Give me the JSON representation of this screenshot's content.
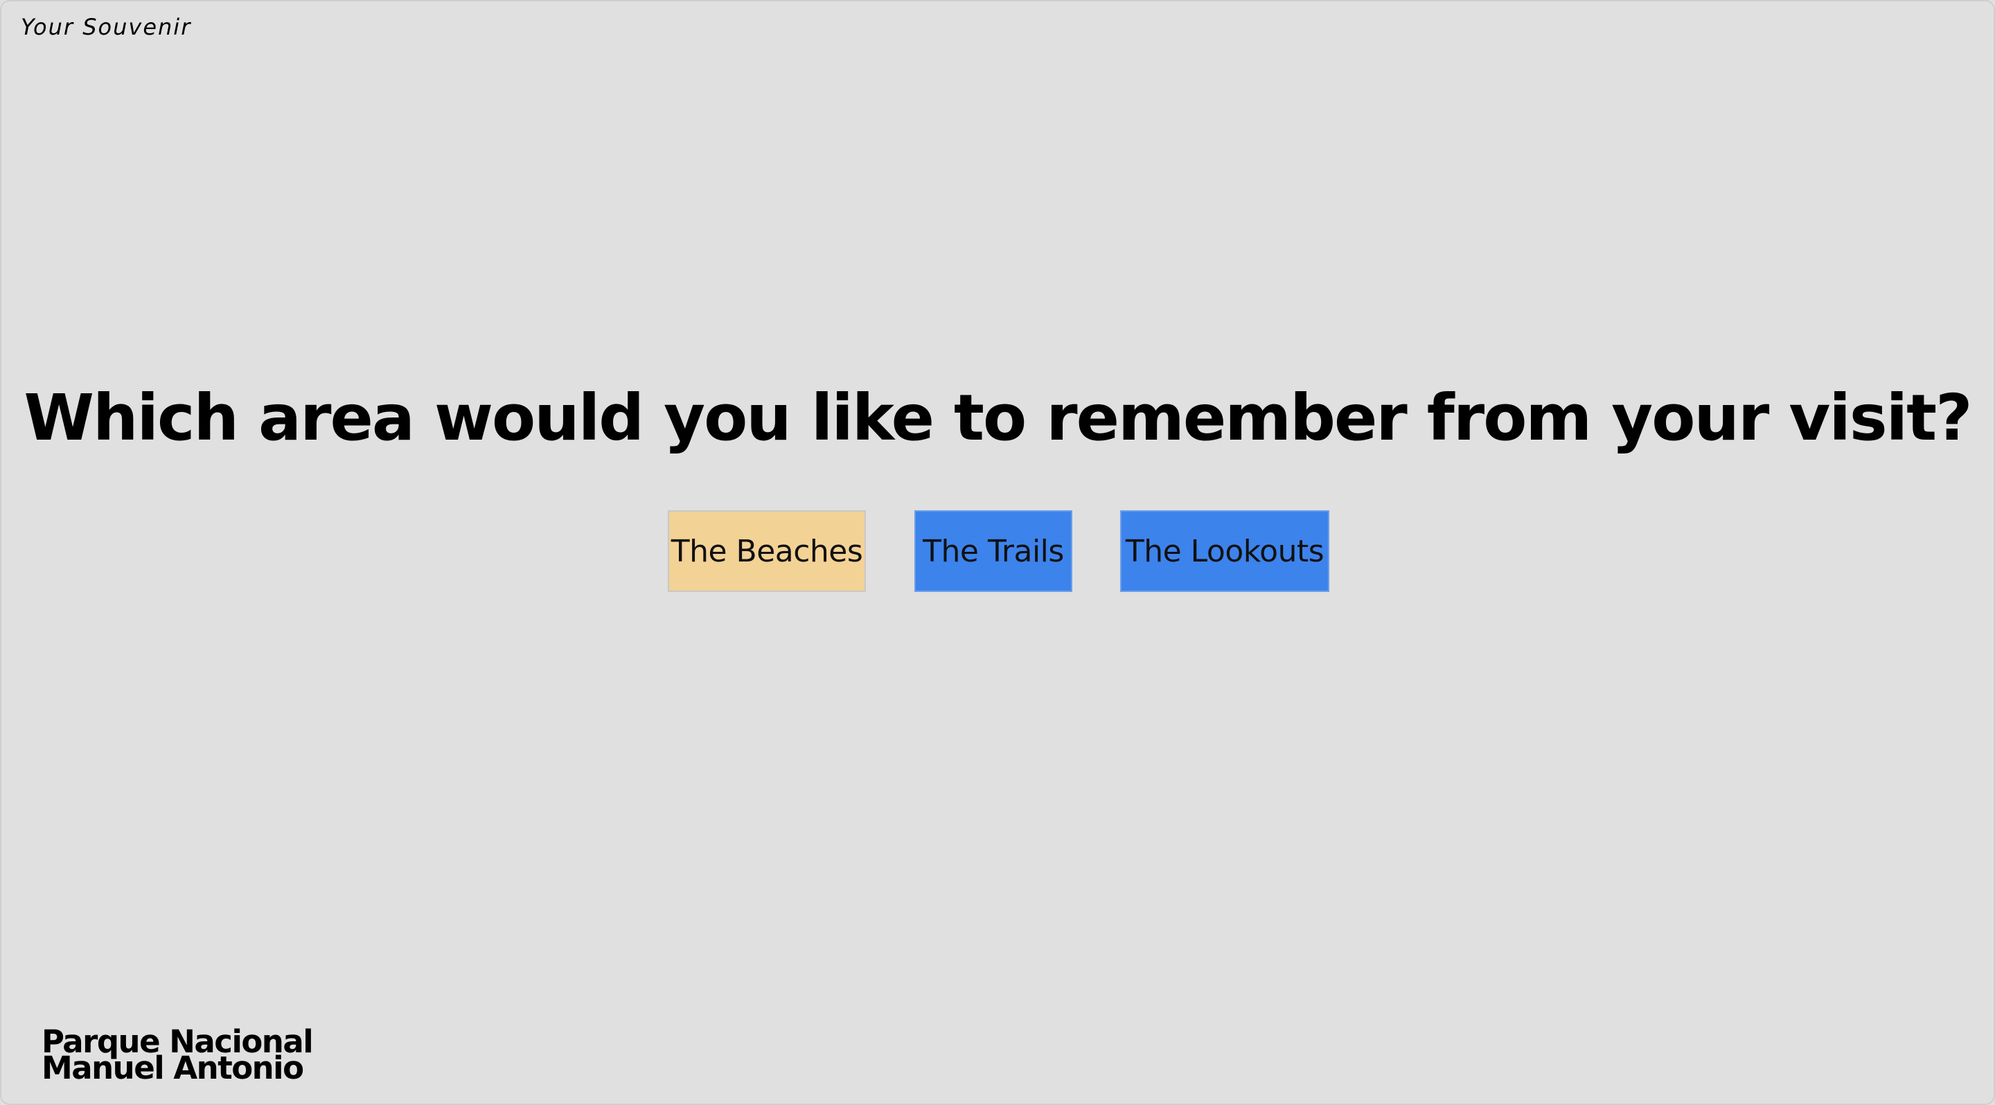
{
  "header": {
    "title": "Your Souvenir"
  },
  "main": {
    "question": "Which area would you like to remember from your visit?",
    "choices": [
      {
        "label": "The Beaches",
        "color": "#f3d295",
        "selected": true
      },
      {
        "label": "The Trails",
        "color": "#3d83ec",
        "selected": false
      },
      {
        "label": "The Lookouts",
        "color": "#3d83ec",
        "selected": false
      }
    ]
  },
  "footer": {
    "logo_line1": "Parque Nacional",
    "logo_line2": "Manuel Antonio"
  },
  "colors": {
    "background": "#e0e0e0",
    "highlight": "#f3d295",
    "accent": "#3d83ec"
  }
}
